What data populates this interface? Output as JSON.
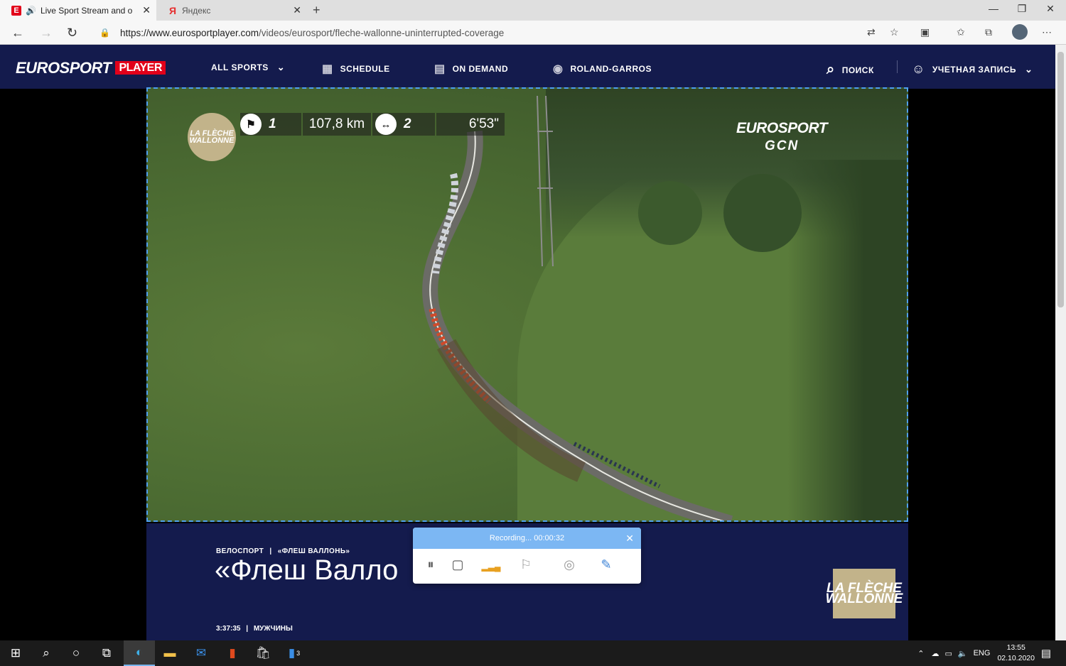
{
  "browser": {
    "tabs": [
      {
        "title": "Live Sport Stream and on D",
        "favicon": "E",
        "active": true,
        "has_audio": true
      },
      {
        "title": "Яндекс",
        "favicon": "Я",
        "active": false,
        "has_audio": false
      }
    ],
    "url_host": "https://www.eurosportplayer.com",
    "url_path": "/videos/eurosport/fleche-wallonne-uninterrupted-coverage"
  },
  "site": {
    "logo_text": "EUROSPORT",
    "logo_badge": "PLAYER",
    "nav": [
      {
        "label": "ALL SPORTS",
        "icon": "chevron-down-icon"
      },
      {
        "label": "SCHEDULE",
        "icon": "calendar-icon"
      },
      {
        "label": "ON DEMAND",
        "icon": "on-demand-icon"
      },
      {
        "label": "ROLAND-GARROS",
        "icon": "roland-garros-icon"
      }
    ],
    "search_label": "ПОИСК",
    "account_label": "УЧЕТНАЯ ЗАПИСЬ"
  },
  "video_overlay": {
    "race_badge": "LA FLÈCHE WALLONNE",
    "group_number": "1",
    "distance": "107,8 km",
    "gap_group": "2",
    "gap_time": "6'53\"",
    "broadcaster_line1": "EUROSPORT",
    "broadcaster_line2": "GCN"
  },
  "info": {
    "breadcrumb_sport": "ВЕЛОСПОРТ",
    "breadcrumb_event": "«ФЛЕШ ВАЛЛОНЬ»",
    "title": "«Флеш Валло",
    "duration": "3:37:35",
    "category": "МУЖЧИНЫ",
    "event_logo": "LA FLÈCHE WALLONNE"
  },
  "recorder": {
    "status": "Recording... 00:00:32"
  },
  "taskbar": {
    "lang": "ENG",
    "time": "13:55",
    "date": "02.10.2020",
    "store_badge": "3"
  },
  "colors": {
    "site_navy": "#141b4d",
    "eurosport_red": "#e2001a",
    "recorder_blue": "#7cb7f3",
    "selection_dash": "#4fa0f0"
  }
}
